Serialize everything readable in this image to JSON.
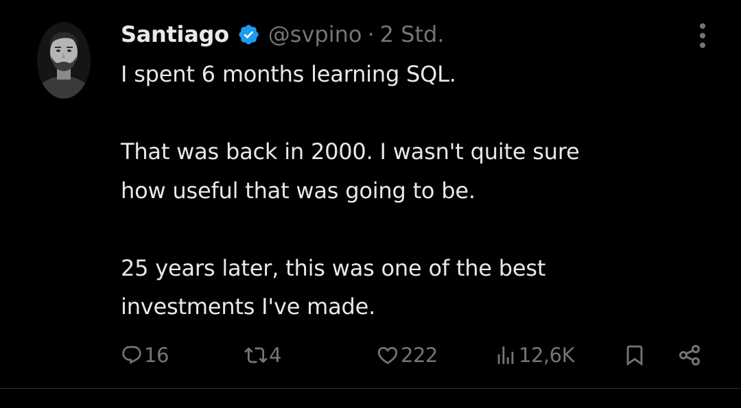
{
  "post": {
    "author": {
      "display_name": "Santiago",
      "verified": true,
      "handle": "@svpino",
      "separator": "·",
      "timestamp": "2 Std."
    },
    "text": {
      "paragraph_1": "I spent 6 months learning SQL.",
      "paragraph_2_line_1": "That was back in 2000. I wasn't quite sure",
      "paragraph_2_line_2": "how useful that was going to be.",
      "paragraph_3_line_1": "25 years later, this was one of the best",
      "paragraph_3_line_2": "investments I've made."
    },
    "metrics": {
      "replies": "16",
      "reposts": "4",
      "likes": "222",
      "views": "12,6K"
    }
  },
  "icons": {
    "more": "more-icon",
    "reply": "reply-icon",
    "repost": "repost-icon",
    "like": "heart-icon",
    "views": "views-icon",
    "bookmark": "bookmark-icon",
    "share": "share-icon",
    "verified": "verified-badge-icon"
  },
  "colors": {
    "background": "#000000",
    "text": "#e7e9ea",
    "secondary": "#71767b",
    "verified": "#1d9bf0"
  }
}
